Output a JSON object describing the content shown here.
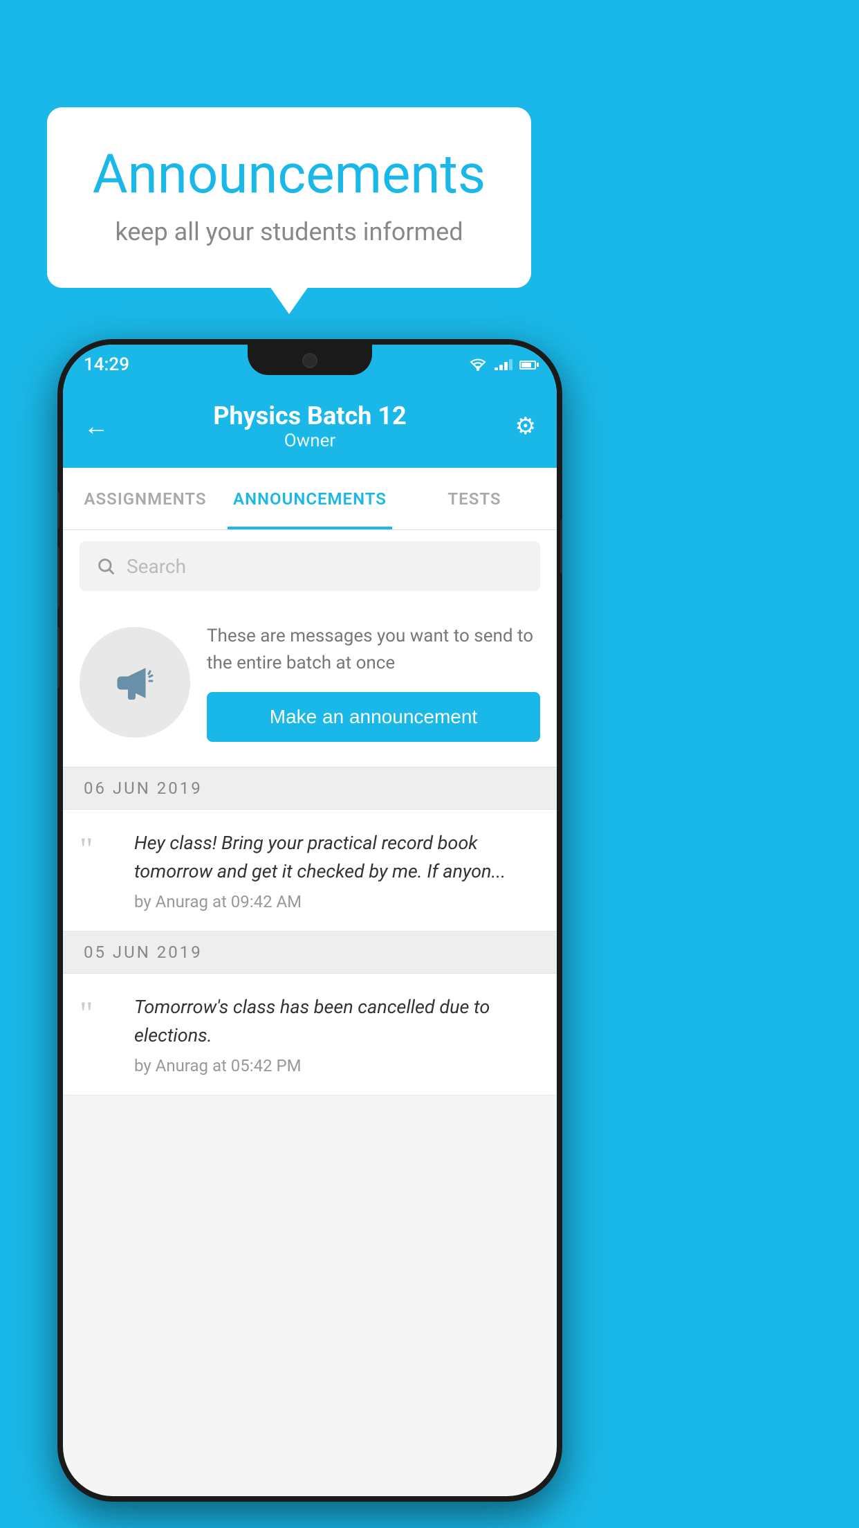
{
  "background_color": "#1ab8e8",
  "speech_bubble": {
    "title": "Announcements",
    "subtitle": "keep all your students informed"
  },
  "phone": {
    "status_bar": {
      "time": "14:29"
    },
    "app_bar": {
      "title": "Physics Batch 12",
      "subtitle": "Owner",
      "back_label": "←",
      "settings_label": "⚙"
    },
    "tabs": [
      {
        "label": "ASSIGNMENTS",
        "active": false
      },
      {
        "label": "ANNOUNCEMENTS",
        "active": true
      },
      {
        "label": "TESTS",
        "active": false
      }
    ],
    "search": {
      "placeholder": "Search"
    },
    "promo": {
      "description": "These are messages you want to send to the entire batch at once",
      "button_label": "Make an announcement"
    },
    "announcements": [
      {
        "date": "06  JUN  2019",
        "text": "Hey class! Bring your practical record book tomorrow and get it checked by me. If anyon...",
        "meta": "by Anurag at 09:42 AM"
      },
      {
        "date": "05  JUN  2019",
        "text": "Tomorrow's class has been cancelled due to elections.",
        "meta": "by Anurag at 05:42 PM"
      }
    ]
  }
}
